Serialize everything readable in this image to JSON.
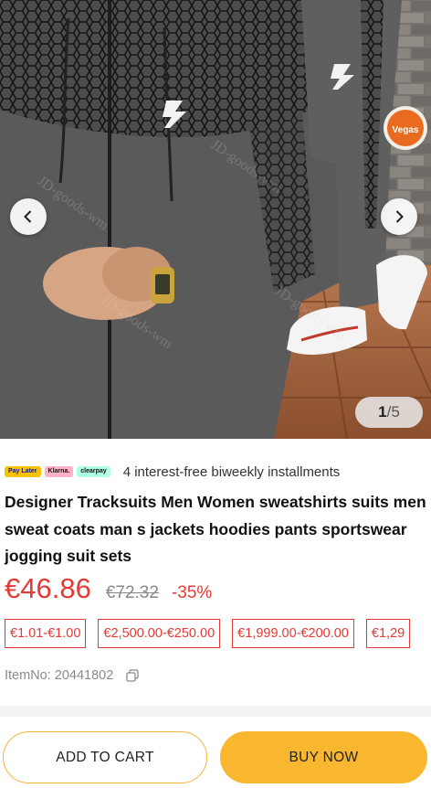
{
  "gallery": {
    "current_index": "1",
    "total": "/5",
    "image_alt": "product-photo"
  },
  "installments": {
    "badges": [
      "Pay Later",
      "Klarna.",
      "clearpay"
    ],
    "text": "4 interest-free biweekly installments"
  },
  "product": {
    "title": "Designer Tracksuits Men Women sweatshirts suits men sweat coats man s jackets hoodies pants sportswear jogging suit sets",
    "price_current": "€46.86",
    "price_original": "€72.32",
    "discount": "-35%",
    "tiers": [
      "€1.01-€1.00",
      "€2,500.00-€250.00",
      "€1,999.00-€200.00",
      "€1,29"
    ],
    "item_no_label": "ItemNo: 20441802"
  },
  "actions": {
    "add_to_cart": "ADD TO CART",
    "buy_now": "BUY NOW"
  },
  "colors": {
    "accent_red": "#e53935",
    "button_yellow": "#f8b72f"
  }
}
